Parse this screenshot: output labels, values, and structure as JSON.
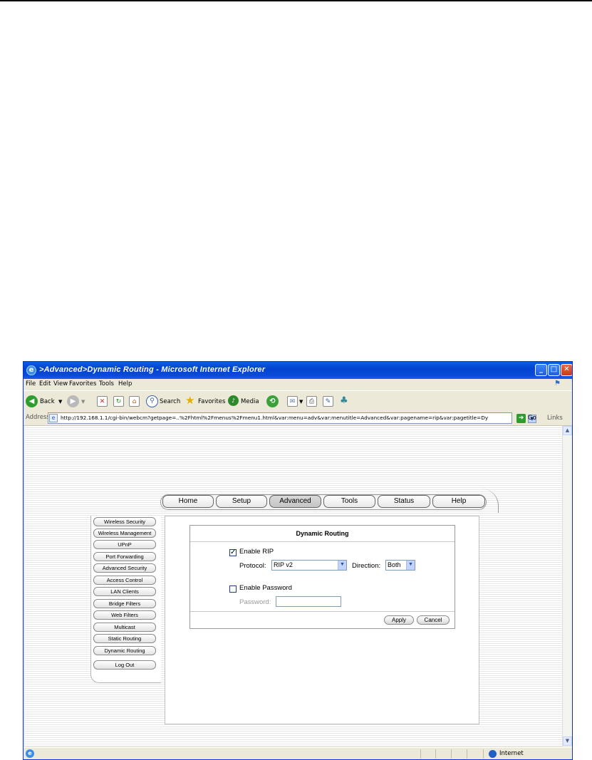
{
  "window": {
    "title": ">Advanced>Dynamic Routing - Microsoft Internet Explorer",
    "buttons": {
      "minimize": "_",
      "maximize": "□",
      "close": "✕"
    }
  },
  "menubar": {
    "items": [
      "File",
      "Edit",
      "View",
      "Favorites",
      "Tools",
      "Help"
    ]
  },
  "toolbar": {
    "back": "Back",
    "search": "Search",
    "favorites": "Favorites",
    "media": "Media"
  },
  "address": {
    "label": "Address",
    "url": "http://192.168.1.1/cgi-bin/webcm?getpage=..%2Fhtml%2Fmenus%2Fmenu1.html&var:menu=adv&var:menutitle=Advanced&var:pagename=rip&var:pagetitle=Dynamic",
    "go": "Go",
    "links": "Links"
  },
  "nav": {
    "tabs": [
      "Home",
      "Setup",
      "Advanced",
      "Tools",
      "Status",
      "Help"
    ],
    "active": "Advanced"
  },
  "sidebar": {
    "items": [
      "Wireless Security",
      "Wireless Management",
      "UPnP",
      "Port Forwarding",
      "Advanced Security",
      "Access Control",
      "LAN Clients",
      "Bridge Filters",
      "Web Filters",
      "Multicast",
      "Static Routing",
      "Dynamic Routing",
      "Log Out"
    ]
  },
  "form": {
    "title": "Dynamic Routing",
    "enable_rip": {
      "label": "Enable RIP",
      "checked": true,
      "mark": "✓"
    },
    "protocol": {
      "label": "Protocol:",
      "value": "RIP v2"
    },
    "direction": {
      "label": "Direction:",
      "value": "Both"
    },
    "enable_password": {
      "label": "Enable Password",
      "checked": false
    },
    "password": {
      "label": "Password:",
      "value": ""
    },
    "apply": "Apply",
    "cancel": "Cancel"
  },
  "status": {
    "zone": "Internet"
  },
  "icons": {
    "ie": "ie-logo-icon",
    "xp": "windows-flag-icon",
    "go": "go-arrow-icon",
    "internet": "globe-icon"
  }
}
